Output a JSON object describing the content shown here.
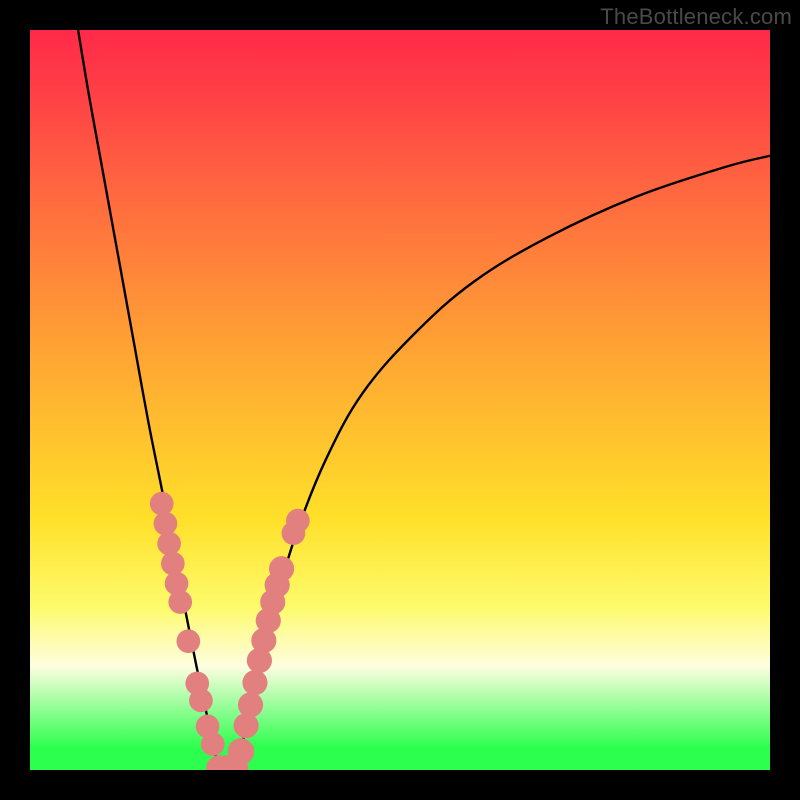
{
  "watermark": "TheBottleneck.com",
  "chart_data": {
    "type": "line",
    "title": "",
    "xlabel": "",
    "ylabel": "",
    "xlim": [
      0,
      100
    ],
    "ylim": [
      0,
      100
    ],
    "gradient_stops": [
      {
        "pct": 0,
        "color": "#ff2a48"
      },
      {
        "pct": 8,
        "color": "#ff3e46"
      },
      {
        "pct": 22,
        "color": "#ff6840"
      },
      {
        "pct": 42,
        "color": "#ffa034"
      },
      {
        "pct": 66,
        "color": "#ffe029"
      },
      {
        "pct": 78,
        "color": "#fdfb6c"
      },
      {
        "pct": 86,
        "color": "#fefde0"
      },
      {
        "pct": 97,
        "color": "#2cff4e"
      },
      {
        "pct": 100,
        "color": "#2cff4e"
      }
    ],
    "series": [
      {
        "name": "left-branch",
        "x": [
          6.5,
          8,
          10,
          12,
          14,
          16,
          18,
          19.5,
          21,
          22.5,
          24,
          25.5
        ],
        "y": [
          100,
          91,
          80,
          69,
          58,
          47,
          37,
          29,
          21.5,
          14,
          7,
          0
        ]
      },
      {
        "name": "valley-floor",
        "x": [
          25.5,
          26.3,
          27.0,
          28.0
        ],
        "y": [
          0,
          0,
          0,
          0
        ]
      },
      {
        "name": "right-branch",
        "x": [
          28.0,
          29.0,
          30.5,
          33,
          36,
          40,
          45,
          52,
          60,
          70,
          82,
          94,
          100
        ],
        "y": [
          0,
          5,
          12,
          22,
          32,
          42,
          51,
          59,
          66,
          72,
          77.5,
          81.5,
          83
        ]
      }
    ],
    "markers": {
      "name": "beads",
      "color": "#e28080",
      "points": [
        {
          "x": 17.8,
          "y": 36,
          "r": 1.6
        },
        {
          "x": 18.3,
          "y": 33.3,
          "r": 1.6
        },
        {
          "x": 18.8,
          "y": 30.6,
          "r": 1.6
        },
        {
          "x": 19.3,
          "y": 27.9,
          "r": 1.6
        },
        {
          "x": 19.8,
          "y": 25.2,
          "r": 1.6
        },
        {
          "x": 20.3,
          "y": 22.7,
          "r": 1.6
        },
        {
          "x": 21.4,
          "y": 17.4,
          "r": 1.6
        },
        {
          "x": 22.6,
          "y": 11.7,
          "r": 1.6
        },
        {
          "x": 23.1,
          "y": 9.4,
          "r": 1.6
        },
        {
          "x": 24.0,
          "y": 5.9,
          "r": 1.6
        },
        {
          "x": 24.7,
          "y": 3.5,
          "r": 1.6
        },
        {
          "x": 25.6,
          "y": 0.2,
          "r": 1.8
        },
        {
          "x": 26.3,
          "y": 0.2,
          "r": 1.8
        },
        {
          "x": 27.0,
          "y": 0.2,
          "r": 1.8
        },
        {
          "x": 27.7,
          "y": 0.2,
          "r": 1.8
        },
        {
          "x": 28.5,
          "y": 2.5,
          "r": 1.8
        },
        {
          "x": 29.2,
          "y": 6.0,
          "r": 1.7
        },
        {
          "x": 29.8,
          "y": 8.8,
          "r": 1.7
        },
        {
          "x": 30.4,
          "y": 11.8,
          "r": 1.7
        },
        {
          "x": 31.0,
          "y": 14.8,
          "r": 1.7
        },
        {
          "x": 31.6,
          "y": 17.5,
          "r": 1.7
        },
        {
          "x": 32.2,
          "y": 20.2,
          "r": 1.7
        },
        {
          "x": 32.8,
          "y": 22.7,
          "r": 1.7
        },
        {
          "x": 33.4,
          "y": 25.0,
          "r": 1.7
        },
        {
          "x": 34.0,
          "y": 27.2,
          "r": 1.7
        },
        {
          "x": 35.6,
          "y": 32.0,
          "r": 1.6
        },
        {
          "x": 36.2,
          "y": 33.7,
          "r": 1.6
        }
      ]
    }
  }
}
